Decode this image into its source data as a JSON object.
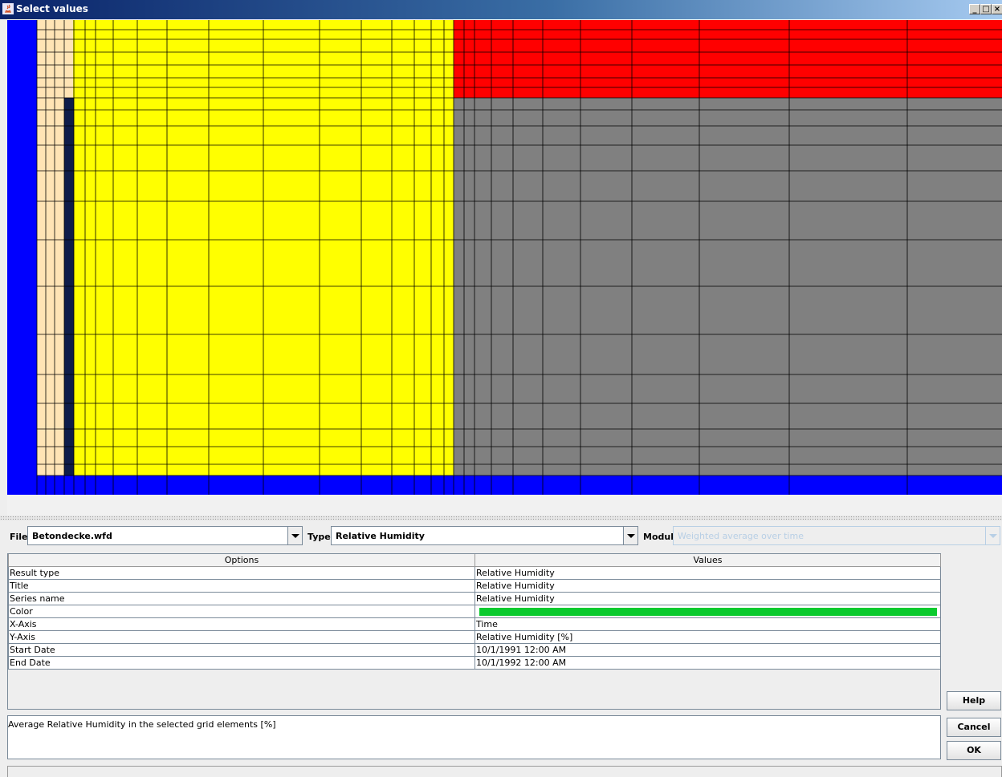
{
  "window": {
    "title": "Select values",
    "minimize_label": "_",
    "maximize_label": "□",
    "close_label": "×"
  },
  "grid": {
    "colors": {
      "boundary": "#0000ff",
      "light_layer": "#ffe4b5",
      "dark_strip": "#0f1d4a",
      "yellow_layer": "#ffff00",
      "red_layer": "#ff0000",
      "gray_layer": "#808080",
      "lines": "#000000"
    }
  },
  "selectors": {
    "file_label": "File",
    "file_value": "Betondecke.wfd",
    "type_label": "Type",
    "type_value": "Relative Humidity",
    "modul_label": "Modul",
    "modul_value": "Weighted average over time"
  },
  "table": {
    "headers": [
      "Options",
      "Values"
    ],
    "rows": [
      {
        "option": "Result type",
        "value": "Relative Humidity"
      },
      {
        "option": "Title",
        "value": "Relative Humidity"
      },
      {
        "option": "Series name",
        "value": "Relative Humidity"
      },
      {
        "option": "Color",
        "value": "",
        "color": "#0aca2e"
      },
      {
        "option": "X-Axis",
        "value": "Time"
      },
      {
        "option": "Y-Axis",
        "value": "Relative Humidity [%]"
      },
      {
        "option": "Start Date",
        "value": "10/1/1991 12:00 AM"
      },
      {
        "option": "End Date",
        "value": "10/1/1992 12:00 AM"
      }
    ]
  },
  "description": "Average Relative Humidity in the selected grid elements [%]",
  "buttons": {
    "help": "Help",
    "cancel": "Cancel",
    "ok": "OK"
  }
}
